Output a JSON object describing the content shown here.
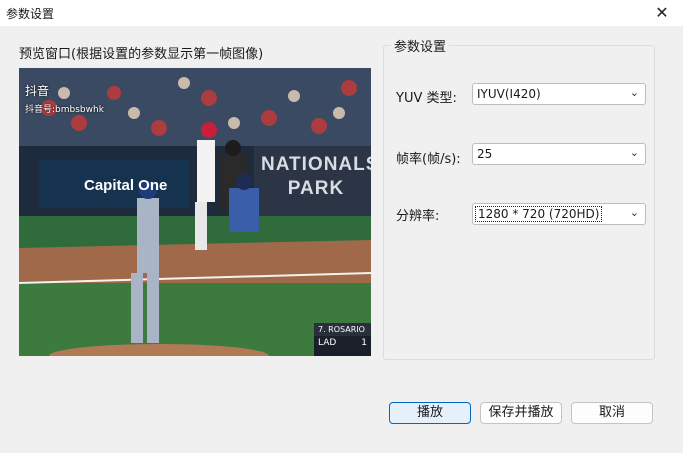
{
  "window": {
    "title": "参数设置",
    "close_glyph": "✕"
  },
  "preview": {
    "label": "预览窗口(根据设置的参数显示第一帧图像)",
    "overlay": {
      "app": "抖音",
      "handle": "抖音号:bmbsbwhk",
      "ad_text": "Capital One",
      "stadium_text": "NATIONALS PARK",
      "score_name": "7. ROSARIO",
      "score_team": "LAD",
      "score_runs": "1"
    }
  },
  "settings": {
    "group_title": "参数设置",
    "yuv_label": "YUV 类型:",
    "yuv_value": "IYUV(I420)",
    "fps_label": "帧率(帧/s):",
    "fps_value": "25",
    "res_label": "分辨率:",
    "res_value": "1280 * 720    (720HD)"
  },
  "buttons": {
    "play": "播放",
    "save_play": "保存并播放",
    "cancel": "取消"
  },
  "colors": {
    "accent": "#0067c0",
    "window_bg": "#f0f0f0"
  }
}
